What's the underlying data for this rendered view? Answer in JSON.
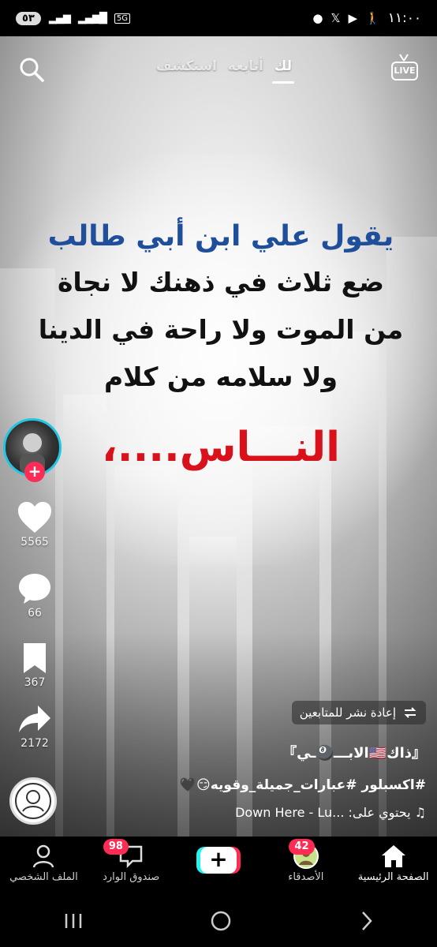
{
  "status_bar": {
    "time": "١١:٠٠",
    "battery": "٥٣",
    "network": "5G"
  },
  "top_nav": {
    "tabs": [
      {
        "label": "لك",
        "active": true
      },
      {
        "label": "أتابعه",
        "active": false
      },
      {
        "label": "استكشف",
        "active": false
      }
    ],
    "live_label": "LIVE",
    "live_icon": "live-tv-icon",
    "search_icon": "search-icon"
  },
  "video": {
    "quote_title": "يقول علي ابن أبي طالب",
    "quote_lines": [
      "ضع ثلاث في ذهنك لا نجاة",
      "من الموت ولا راحة في الدينا",
      "ولا سلامه من كلام"
    ],
    "quote_end": "النـــاس....،"
  },
  "actions": {
    "likes": "5565",
    "comments": "66",
    "saves": "367",
    "shares": "2172"
  },
  "overlay": {
    "repost_label": "إعادة نشر للمتابعين",
    "author": "『ذاك🇺🇸الابـــ🎱ـي』",
    "caption": "#اكسبلور #عبارات_جميلة_وقويه😏🖤",
    "music_prefix": "يحتوي على:",
    "music_title": "Down Here - Lu..."
  },
  "bottom_nav": {
    "items": [
      {
        "label": "الصفحة الرئيسية",
        "active": true
      },
      {
        "label": "الأصدقاء",
        "badge": "42"
      },
      {
        "label": "",
        "create": true
      },
      {
        "label": "صندوق الوارد",
        "badge": "98"
      },
      {
        "label": "الملف الشخصي"
      }
    ]
  },
  "colors": {
    "accent": "#fe2c55",
    "accent_secondary": "#25f4ee",
    "quote_title": "#1f4e9a",
    "quote_end": "#d9111b"
  }
}
